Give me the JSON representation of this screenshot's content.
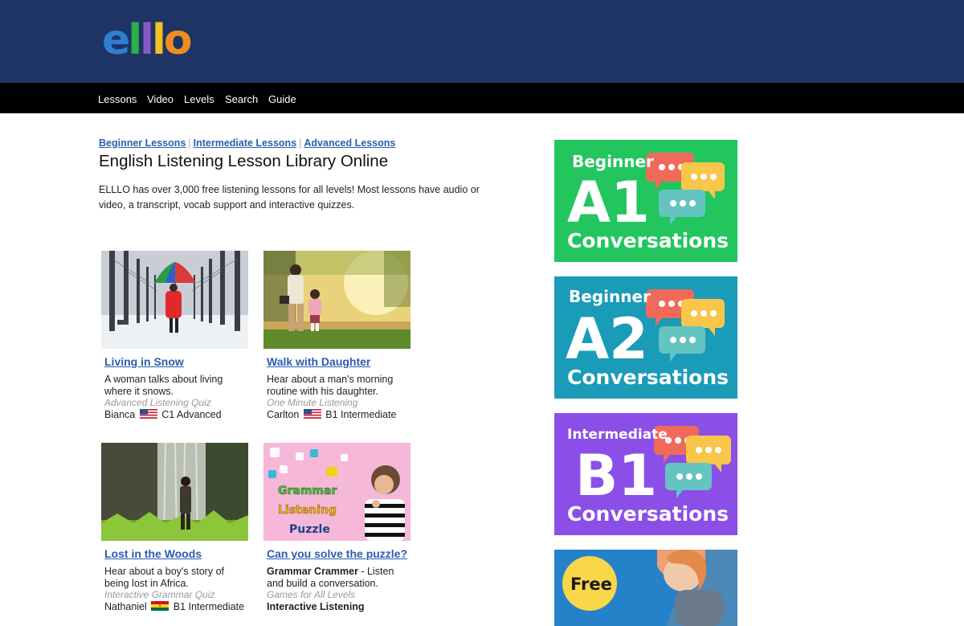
{
  "site": {
    "logo_text": "elllo"
  },
  "nav": {
    "items": [
      "Lessons",
      "Video",
      "Levels",
      "Search",
      "Guide"
    ]
  },
  "breadcrumbs": [
    "Beginner Lessons",
    "Intermediate Lessons",
    "Advanced Lessons"
  ],
  "page": {
    "title": "English Listening Lesson Library Online",
    "intro": "ELLLO has over 3,000 free listening lessons for all levels! Most lessons have audio or video, a transcript, vocab support and interactive quizzes."
  },
  "lessons": [
    {
      "title": "Living in Snow",
      "desc": "A woman talks about living where it snows.",
      "category": "Advanced Listening Quiz",
      "speaker": "Bianca",
      "level": "C1 Advanced",
      "flag": "us-flag-icon"
    },
    {
      "title": "Walk with Daughter",
      "desc": "Hear about a man's morning routine with his daughter.",
      "category": "One Minute Listening",
      "speaker": "Carlton",
      "level": "B1 Intermediate",
      "flag": "us-flag-icon"
    },
    {
      "title": "Lost in the Woods",
      "desc": "Hear about a boy's story of being lost in Africa.",
      "category": "Interactive Grammar Quiz",
      "speaker": "Nathaniel",
      "level": "B1 Intermediate",
      "flag": "ghana-flag-icon"
    },
    {
      "title": "Can you solve the puzzle?",
      "desc_bold": "Grammar Crammer",
      "desc": " - Listen and build a conversation.",
      "category": "Games for All Levels",
      "meta_bold": "Interactive Listening"
    }
  ],
  "puzzle_thumb": {
    "line1": "Grammar",
    "line2": "Listening",
    "line3": "Puzzle"
  },
  "ads": [
    {
      "top": "Beginner",
      "big": "A1",
      "bottom": "Conversations",
      "bg": "#22c55e"
    },
    {
      "top": "Beginner",
      "big": "A2",
      "bottom": "Conversations",
      "bg": "#1a9bb8"
    },
    {
      "top": "Intermediate",
      "big": "B1",
      "bottom": "Conversations",
      "bg": "#8b4fe8"
    },
    {
      "badge": "Free",
      "bg": "#2a8fd6"
    }
  ],
  "colors": {
    "header": "#1e3464",
    "nav": "#000000",
    "link": "#2a5db0"
  }
}
